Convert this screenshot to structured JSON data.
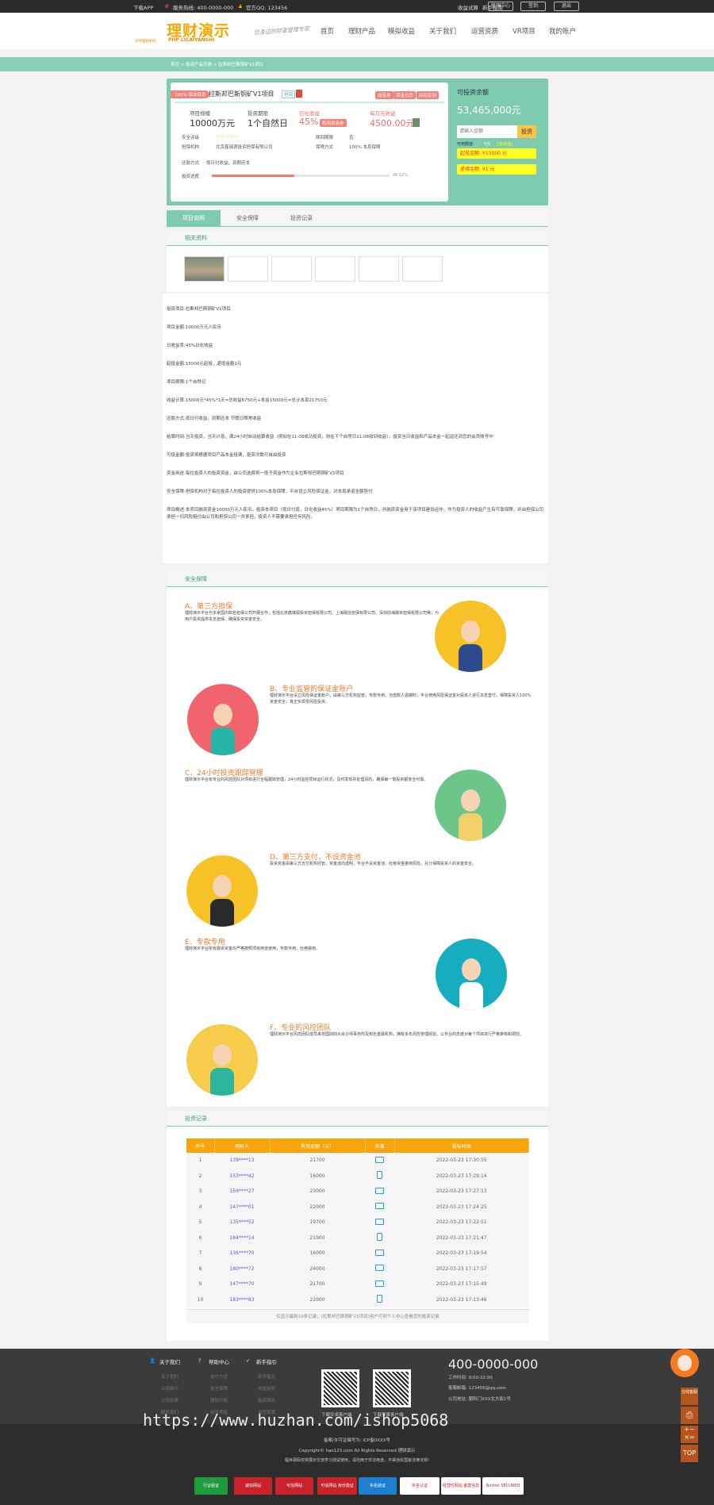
{
  "topbar": {
    "app": "下载APP",
    "hotline": "服务热线: 400-0000-000",
    "qq": "官方QQ: 123456",
    "calc": "收益试算",
    "guide": "新手指南",
    "admin": "管理中心",
    "signin": "签到",
    "logout": "退出"
  },
  "header": {
    "logo": "理财演示",
    "logo_sub": "PHP LICAIYANSHI",
    "logo_tag": "APP理财系统",
    "slogan": "您身边的财富管理专家",
    "nav": [
      "首页",
      "理财产品",
      "模拟收益",
      "关于我们",
      "运营资质",
      "VR项目",
      "我的账户"
    ]
  },
  "breadcrumb": "首页 > 投资产品列表 > 拉斯邦巴斯铜矿V1项目",
  "project": {
    "badge": "100% 保本保息",
    "title": "拉斯邦巴斯铜矿V1项目",
    "tag": "担保",
    "actions": [
      "加息券",
      "资金日历",
      "特权定制"
    ],
    "scale_label": "项目规模",
    "scale": "10000万元",
    "term_label": "投资期限",
    "term": "1个自然日",
    "rate_label": "日化收益",
    "rate": "45%",
    "rate_tag": "使用加息券",
    "per_label": "每万元收益",
    "per": "4500.00元",
    "rating_label": "安全评级",
    "rating": "☆☆☆☆☆",
    "redeem_label": "赎回期限",
    "redeem": "否",
    "guarantor_label": "担保机构",
    "guarantor": "北京鑫瑞源投资担保有限公司",
    "protect_label": "保障方式",
    "protect": "100% 本息保障",
    "repay_label": "还款方式",
    "repay": "按日付收益，到期还本",
    "progress_label": "投资进度",
    "progress_text": "46.52%",
    "progress": 46.52
  },
  "invest": {
    "title": "可投资余额",
    "amount": "53,465,000元",
    "placeholder": "请输入金额",
    "button": "投资",
    "avail_label": "可用额度:",
    "avail": "0元",
    "recharge": "[去充值]",
    "min": "起投金额: ¥15000 元",
    "step": "递增金额: ¥1 元"
  },
  "tabs": [
    "项目说明",
    "安全保障",
    "投资记录"
  ],
  "materials": "相关资料",
  "description": [
    "投资项目:拉斯邦巴斯铜矿V1项目",
    "项目金额:10000万元人民币",
    "日收益率:45%日化收益",
    "起投金额:15000元起投，递增金额1元",
    "项目期限:1个自然日",
    "收益计算:15000元*45%*1天=总收益6750元+本金15000元=总计本息21750元",
    "还款方式:按日付收益，到期还本 节假日照常收益",
    "结算时间:当天投资，当天计息，满24小时自动结算收益（例如在11:08成功投资，则在下个自然日11:08收到收益），投资当日收益和产品本金一起返还到您的会员账号中",
    "可投金额:投资将根据项目产品本金投满，投资次数可自由投资",
    "资金用途:每位投资人的投资资金，由公司选择将一揽子资金作为企业拉斯邦巴斯铜矿V1项目",
    "安全保障:担保机构对于每位投资人的投资提供100%本息保障，平台设立风险保证金，对本息承诺全额垫付",
    "项目概述:本项目融资资金10000万元人民币，投资本项目（按日付息，日化收益45%）项目期限为1个自然日，并融资资金用于该项目建设运作，作为投资人的收益产生有可靠保障，并由担保公司承担一切风险赔付由公司和担保公司一并承担，投资人不需要承担任何风险。"
  ],
  "security": {
    "title": "安全保障",
    "items": [
      {
        "title": "A、第三方担保",
        "text": "理财演示平台与多家国内知名担保公司开展合作，包括北京鑫瑞源投资担保有限公司、上海融信担保有限公司、深圳前海融资担保有限公司等，为用户投资提供本息担保，确保投资资金安全。"
      },
      {
        "title": "B、专业监管的保证金账户",
        "text": "理财演示平台设立风险保证金账户，由第三方机构监管，专款专用，当借款人逾期时，平台使用风险保证金对投资人进行本息垫付，保障投资人100%资金安全，真正实现零风险投资。"
      },
      {
        "title": "C、24小时投资跟踪管理",
        "text": "理财演示平台有专业的风控团队对项目进行全程跟踪管理，24小时监控项目运行状况，及时发现并处理风险，确保每一笔投资都安全可靠。"
      },
      {
        "title": "D、第三方支付，不设资金池",
        "text": "投资资金由第三方支付机构托管，资金流向透明，平台不设资金池，杜绝资金挪用风险，充分保障投资人的资金安全。"
      },
      {
        "title": "E、专款专用",
        "text": "理财演示平台所有融资资金均严格按照项目用途使用，专款专用，杜绝挪用。"
      },
      {
        "title": "F、专业的风控团队",
        "text": "理财演示平台风控团队成员来自国际四大会计师事务所及知名金融机构，拥有多年风险管理经验，以专业的态度对每个项目进行严格审核和把控。"
      }
    ]
  },
  "records": {
    "title": "投资记录",
    "headers": [
      "序号",
      "理财人",
      "有效金额（元）",
      "来源",
      "投标时间"
    ],
    "rows": [
      [
        "1",
        "139****13",
        "21700",
        "pc",
        "2022-03-23 17:30:55"
      ],
      [
        "2",
        "153****42",
        "16000",
        "mobile",
        "2022-03-23 17:29:14"
      ],
      [
        "3",
        "159****27",
        "23000",
        "pc",
        "2022-03-23 17:27:13"
      ],
      [
        "4",
        "147****01",
        "22000",
        "pc",
        "2022-03-23 17:24:25"
      ],
      [
        "5",
        "135****52",
        "19700",
        "pc",
        "2022-03-23 17:22:51"
      ],
      [
        "6",
        "184****14",
        "21900",
        "mobile",
        "2022-03-23 17:21:47"
      ],
      [
        "7",
        "136****70",
        "16000",
        "pc",
        "2022-03-23 17:19:54"
      ],
      [
        "8",
        "180****72",
        "24000",
        "pc",
        "2022-03-23 17:17:57"
      ],
      [
        "9",
        "147****70",
        "21700",
        "pc",
        "2022-03-23 17:15:49"
      ],
      [
        "10",
        "183****83",
        "22000",
        "mobile",
        "2022-03-23 17:13:46"
      ]
    ],
    "note": "仅显示最新10条记录，(拉斯邦巴斯铜矿V1项目)用户可到个人中心查看您的投资记录"
  },
  "footer": {
    "cols": [
      {
        "title": "关于我们",
        "links": [
          "关于我们",
          "公司简介",
          "公司资质",
          "联系我们"
        ]
      },
      {
        "title": "帮助中心",
        "links": [
          "支付方式",
          "安全保障",
          "理财介绍",
          "会员等级"
        ]
      },
      {
        "title": "新手指引",
        "links": [
          "新手指引",
          "收益说明",
          "投资项目",
          "运营资质"
        ]
      }
    ],
    "qr": [
      "下载安卓客户端",
      "下载苹果客户端"
    ],
    "phone": "400-0000-000",
    "hours": "工作时间:  9:00-22:00",
    "email": "客服邮箱:  123456@qq.com",
    "address": "公司地址:  朝阳门XXX北大街1号",
    "icp": "备案/许可证编号为: ICP备0XXX号",
    "copyright": "Copyright© hao123.com All Rights Reserved 理财演示",
    "disclaimer": "程序源码仅供展示交流学习测试使用，请勿用于非法用途，不得违反国家法律法规!",
    "badges": [
      "行业验证",
      "诚信网站",
      "可信网站",
      "可信网站 身份验证",
      "实名验证",
      "实名认证",
      "经营性网站 备案信息",
      "Norton SECURED"
    ],
    "watermark": "https://www.huzhan.com/ishop5068"
  },
  "side": {
    "service": "在线客服",
    "top": "TOP"
  },
  "colors": {
    "green": "#7fcbb0",
    "orange": "#f8a40a",
    "red": "#f06e62"
  }
}
